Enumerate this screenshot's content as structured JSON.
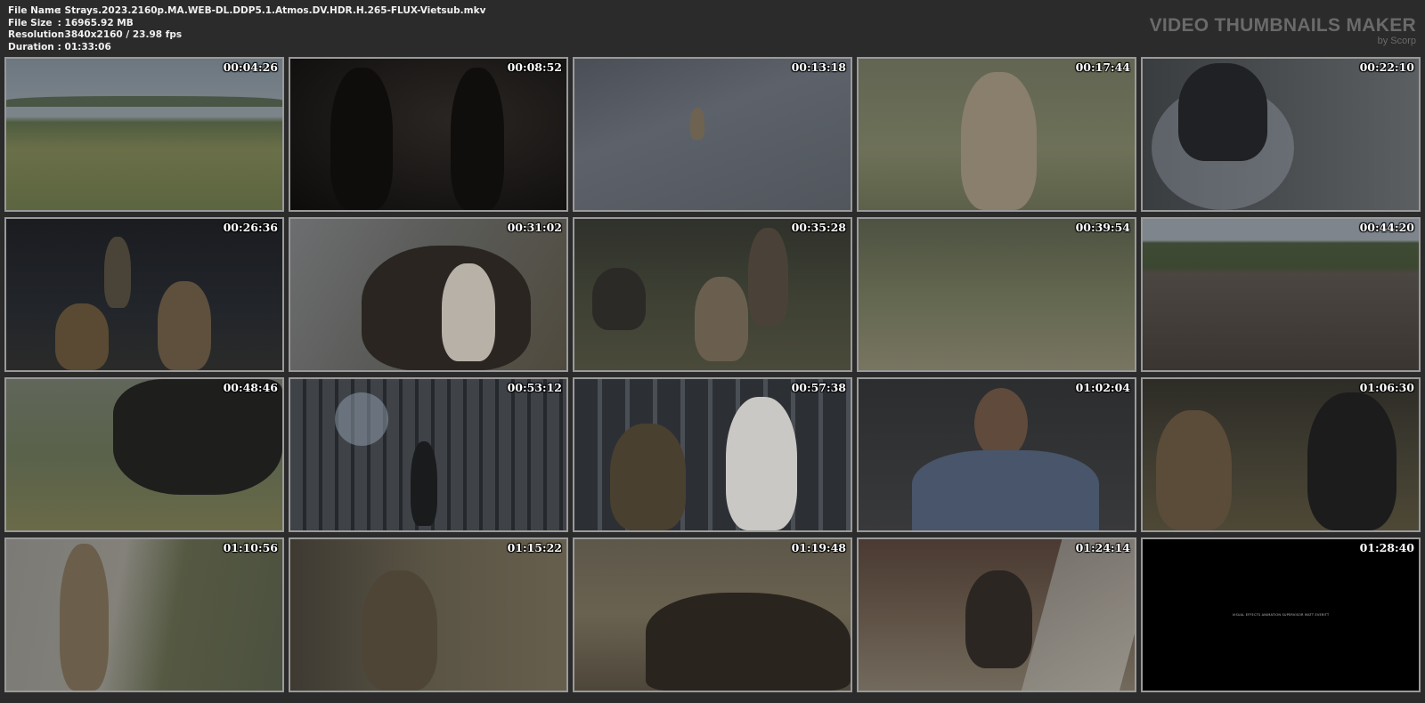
{
  "file_info": {
    "file_name_label": "File Name",
    "file_name": ": Strays.2023.2160p.MA.WEB-DL.DDP5.1.Atmos.DV.HDR.H.265-FLUX-Vietsub.mkv",
    "file_size_label": "File Size",
    "file_size": ": 16965.92 MB",
    "resolution_label": "Resolution",
    "resolution": ": 3840x2160 / 23.98 fps",
    "duration_label": "Duration",
    "duration": ": 01:33:06"
  },
  "brand": {
    "title": "VIDEO THUMBNAILS MAKER",
    "subtitle": "by Scorp"
  },
  "thumbnails": [
    {
      "timestamp": "00:04:26"
    },
    {
      "timestamp": "00:08:52"
    },
    {
      "timestamp": "00:13:18"
    },
    {
      "timestamp": "00:17:44"
    },
    {
      "timestamp": "00:22:10"
    },
    {
      "timestamp": "00:26:36"
    },
    {
      "timestamp": "00:31:02"
    },
    {
      "timestamp": "00:35:28"
    },
    {
      "timestamp": "00:39:54"
    },
    {
      "timestamp": "00:44:20"
    },
    {
      "timestamp": "00:48:46"
    },
    {
      "timestamp": "00:53:12"
    },
    {
      "timestamp": "00:57:38"
    },
    {
      "timestamp": "01:02:04"
    },
    {
      "timestamp": "01:06:30"
    },
    {
      "timestamp": "01:10:56"
    },
    {
      "timestamp": "01:15:22"
    },
    {
      "timestamp": "01:19:48"
    },
    {
      "timestamp": "01:24:14"
    },
    {
      "timestamp": "01:28:40",
      "credit_text": "VISUAL EFFECTS ANIMATION SUPERVISOR     MATT EVERITT"
    }
  ]
}
